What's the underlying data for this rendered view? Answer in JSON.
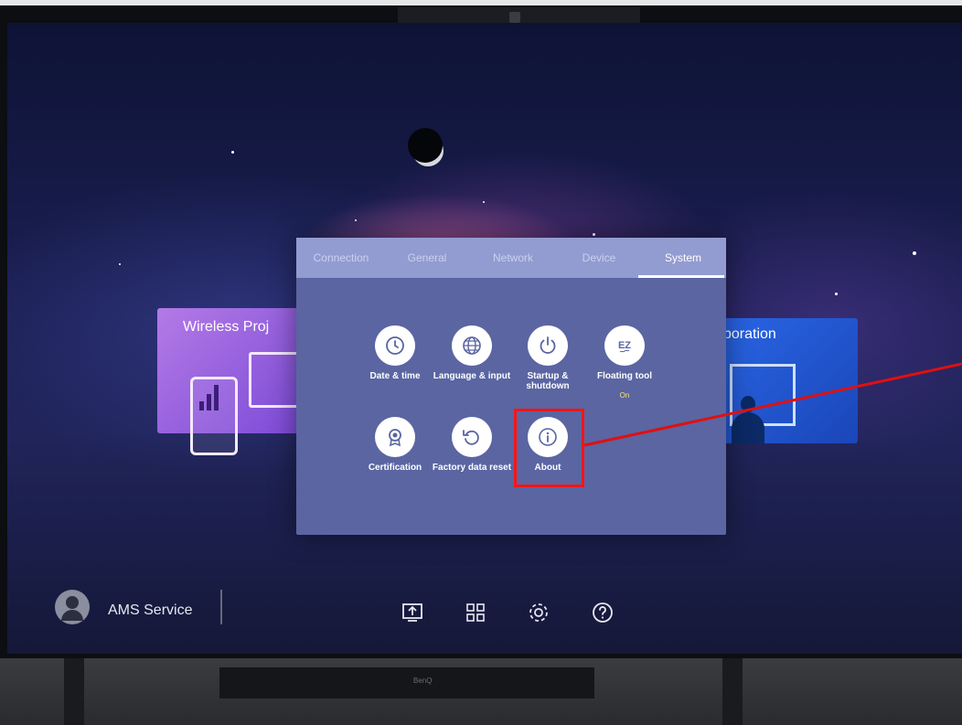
{
  "tabs": [
    {
      "label": "Connection"
    },
    {
      "label": "General"
    },
    {
      "label": "Network"
    },
    {
      "label": "Device"
    },
    {
      "label": "System"
    }
  ],
  "active_tab": "System",
  "cards": {
    "left_title": "Wireless Proj",
    "right_title": "llaboration"
  },
  "system_items": [
    {
      "label": "Date & time",
      "icon": "clock-icon"
    },
    {
      "label": "Language & input",
      "icon": "globe-icon"
    },
    {
      "label": "Startup & shutdown",
      "icon": "power-icon"
    },
    {
      "label": "Floating tool",
      "sublabel": "On",
      "icon": "ez-icon"
    },
    {
      "label": "Certification",
      "icon": "badge-icon"
    },
    {
      "label": "Factory data reset",
      "icon": "reset-icon"
    },
    {
      "label": "About",
      "icon": "info-icon"
    }
  ],
  "taskbar": {
    "user_name": "AMS Service",
    "icons": [
      "screen-share-icon",
      "apps-grid-icon",
      "settings-gear-icon",
      "help-icon"
    ]
  },
  "brand_text": "BenQ",
  "colors": {
    "panel": "#5a65a2",
    "tab_bar": "#939cd0",
    "highlight": "#ff1414",
    "sublabel": "#ffe36a"
  }
}
